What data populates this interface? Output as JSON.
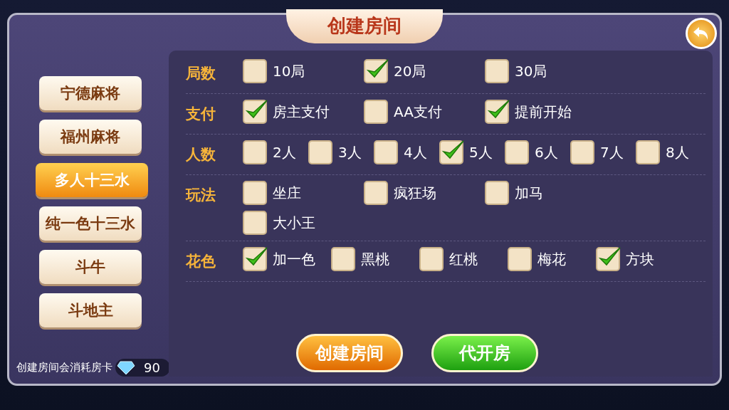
{
  "title": "创建房间",
  "games": [
    {
      "label": "宁德麻将",
      "selected": false
    },
    {
      "label": "福州麻将",
      "selected": false
    },
    {
      "label": "多人十三水",
      "selected": true
    },
    {
      "label": "纯一色十三水",
      "selected": false
    },
    {
      "label": "斗牛",
      "selected": false
    },
    {
      "label": "斗地主",
      "selected": false
    }
  ],
  "note": "创建房间会消耗房卡",
  "card_count": "90",
  "sections": [
    {
      "label": "局数",
      "rows": [
        [
          {
            "label": "10局",
            "checked": false
          },
          {
            "label": "20局",
            "checked": true
          },
          {
            "label": "30局",
            "checked": false
          }
        ]
      ]
    },
    {
      "label": "支付",
      "rows": [
        [
          {
            "label": "房主支付",
            "checked": true
          },
          {
            "label": "AA支付",
            "checked": false
          },
          {
            "label": "提前开始",
            "checked": true
          }
        ]
      ]
    },
    {
      "label": "人数",
      "rows": [
        [
          {
            "label": "2人",
            "checked": false
          },
          {
            "label": "3人",
            "checked": false
          },
          {
            "label": "4人",
            "checked": false
          },
          {
            "label": "5人",
            "checked": true
          },
          {
            "label": "6人",
            "checked": false
          },
          {
            "label": "7人",
            "checked": false
          },
          {
            "label": "8人",
            "checked": false
          }
        ]
      ]
    },
    {
      "label": "玩法",
      "rows": [
        [
          {
            "label": "坐庄",
            "checked": false
          },
          {
            "label": "疯狂场",
            "checked": false
          },
          {
            "label": "加马",
            "checked": false
          }
        ],
        [
          {
            "label": "大小王",
            "checked": false
          }
        ]
      ]
    },
    {
      "label": "花色",
      "rows": [
        [
          {
            "label": "加一色",
            "checked": true
          },
          {
            "label": "黑桃",
            "checked": false
          },
          {
            "label": "红桃",
            "checked": false
          },
          {
            "label": "梅花",
            "checked": false
          },
          {
            "label": "方块",
            "checked": true
          }
        ]
      ]
    }
  ],
  "buttons": [
    {
      "label": "创建房间",
      "kind": "primary"
    },
    {
      "label": "代开房",
      "kind": "secondary"
    }
  ]
}
